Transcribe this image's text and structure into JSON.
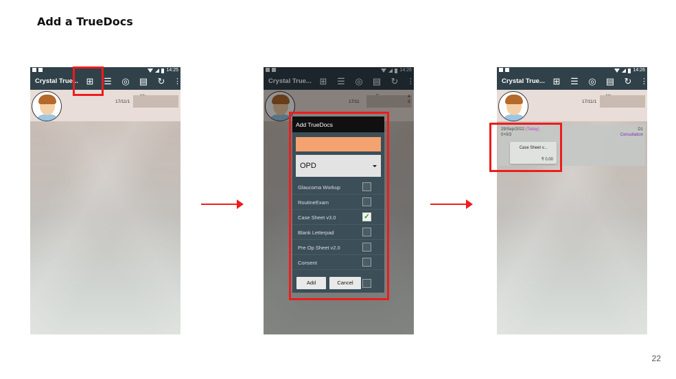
{
  "slide": {
    "title": "Add a TrueDocs",
    "page_number": "22"
  },
  "status_bars": [
    {
      "time": "14:25"
    },
    {
      "time": "14:26"
    },
    {
      "time": "14:26"
    }
  ],
  "app_bar": {
    "title": "Crystal True...",
    "icons": [
      "add-document-icon",
      "checklist-icon",
      "camera-icon",
      "print-icon",
      "sync-icon",
      "more-vert-icon"
    ]
  },
  "patient": {
    "name_partial_1": "Mr",
    "date_partial_1": "17/11/1",
    "name_partial_2": "F",
    "suffix_2": "a",
    "date_partial_2": "17/11",
    "suffix_2b": "3",
    "name_partial_3": "Mr.",
    "date_partial_3": "17/11/1"
  },
  "dialog": {
    "title": "Add TrueDocs",
    "selected_type": "OPD",
    "options": [
      {
        "label": "Glaucoma Workup",
        "checked": false
      },
      {
        "label": "RoutineExam",
        "checked": false
      },
      {
        "label": "Case Sheet v3.0",
        "checked": true
      },
      {
        "label": "Blank Letterpad",
        "checked": false
      },
      {
        "label": "Pre Op Sheet v2.0",
        "checked": false
      },
      {
        "label": "Consent",
        "checked": false
      }
    ],
    "add_label": "Add",
    "cancel_label": "Cancel"
  },
  "doc_card": {
    "date": "29/Sep/2022",
    "today": "(Today)",
    "count": "0+0/3",
    "code": "D1",
    "type": "Consultation",
    "doc_title": "Case Sheet v...",
    "amount": "₹ 0.00"
  },
  "colors": {
    "highlight": "#ee1c1c",
    "app_bar": "#30414a",
    "orange_field": "#f4a26f"
  }
}
